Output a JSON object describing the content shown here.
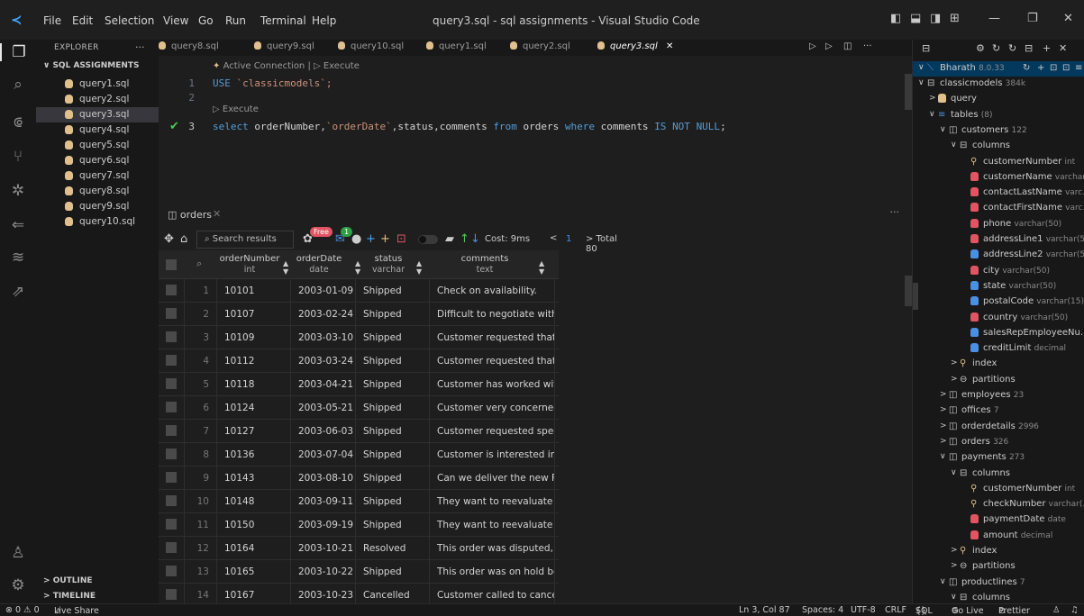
{
  "window": {
    "menu": [
      "File",
      "Edit",
      "Selection",
      "View",
      "Go",
      "Run",
      "Terminal",
      "Help"
    ],
    "title": "query3.sql - sql assignments - Visual Studio Code"
  },
  "sidebar": {
    "header": "EXPLORER",
    "dots": "···",
    "folder": "SQL ASSIGNMENTS",
    "files": [
      "query1.sql",
      "query2.sql",
      "query3.sql",
      "query4.sql",
      "query5.sql",
      "query6.sql",
      "query7.sql",
      "query8.sql",
      "query9.sql",
      "query10.sql"
    ],
    "active_file": "query3.sql",
    "outline": "OUTLINE",
    "timeline": "TIMELINE"
  },
  "tabs": [
    "query8.sql",
    "query9.sql",
    "query10.sql",
    "query1.sql",
    "query2.sql",
    "query3.sql"
  ],
  "active_tab": "query3.sql",
  "editor": {
    "codelens_top": "Active Connection | ▷ Execute",
    "codelens_mid": "▷ Execute",
    "lines": [
      {
        "n": "1",
        "kw": "USE",
        "rest": " `classicmodels`;"
      },
      {
        "n": "2"
      },
      {
        "n": "3",
        "text": "select orderNumber,`orderDate`,status,comments from orders where comments IS NOT NULL;"
      }
    ]
  },
  "results": {
    "tab_label": "orders",
    "search_placeholder": "Search results",
    "badge_free": "Free",
    "badge_count": "1",
    "cost": "Cost: 9ms",
    "page_prev": "<",
    "page": "1",
    "total": "> Total 80",
    "columns": [
      {
        "name": "orderNumber",
        "type": "int"
      },
      {
        "name": "orderDate",
        "type": "date"
      },
      {
        "name": "status",
        "type": "varchar"
      },
      {
        "name": "comments",
        "type": "text"
      }
    ],
    "rows": [
      [
        "1",
        "10101",
        "2003-01-09",
        "Shipped",
        "Check on availability."
      ],
      [
        "2",
        "10107",
        "2003-02-24",
        "Shipped",
        "Difficult to negotiate with c"
      ],
      [
        "3",
        "10109",
        "2003-03-10",
        "Shipped",
        "Customer requested that Fe"
      ],
      [
        "4",
        "10112",
        "2003-03-24",
        "Shipped",
        "Customer requested that ac"
      ],
      [
        "5",
        "10118",
        "2003-04-21",
        "Shipped",
        "Customer has worked with"
      ],
      [
        "6",
        "10124",
        "2003-05-21",
        "Shipped",
        "Customer very concerned a"
      ],
      [
        "7",
        "10127",
        "2003-06-03",
        "Shipped",
        "Customer requested specia"
      ],
      [
        "8",
        "10136",
        "2003-07-04",
        "Shipped",
        "Customer is interested in bu"
      ],
      [
        "9",
        "10143",
        "2003-08-10",
        "Shipped",
        "Can we deliver the new For"
      ],
      [
        "10",
        "10148",
        "2003-09-11",
        "Shipped",
        "They want to reevaluate the"
      ],
      [
        "11",
        "10150",
        "2003-09-19",
        "Shipped",
        "They want to reevaluate the"
      ],
      [
        "12",
        "10164",
        "2003-10-21",
        "Resolved",
        "This order was disputed, bu"
      ],
      [
        "13",
        "10165",
        "2003-10-22",
        "Shipped",
        "This order was on hold bec"
      ],
      [
        "14",
        "10167",
        "2003-10-23",
        "Cancelled",
        "Customer called to cancel."
      ]
    ]
  },
  "db": {
    "connection": "Bharath",
    "connection_version": "8.0.33",
    "tree": [
      {
        "d": 1,
        "chev": "∨",
        "icon": "db",
        "label": "classicmodels",
        "meta": "384k"
      },
      {
        "d": 2,
        "chev": ">",
        "icon": "query",
        "label": "query",
        "meta": ""
      },
      {
        "d": 2,
        "chev": "∨",
        "icon": "list",
        "label": "tables",
        "meta": "(8)"
      },
      {
        "d": 3,
        "chev": "∨",
        "icon": "table",
        "label": "customers",
        "meta": "122"
      },
      {
        "d": 4,
        "chev": "∨",
        "icon": "cols",
        "label": "columns",
        "meta": ""
      },
      {
        "d": 5,
        "chev": "",
        "icon": "key",
        "label": "customerNumber",
        "meta": "int"
      },
      {
        "d": 5,
        "chev": "",
        "icon": "red",
        "label": "customerName",
        "meta": "varchar..."
      },
      {
        "d": 5,
        "chev": "",
        "icon": "red",
        "label": "contactLastName",
        "meta": "varc..."
      },
      {
        "d": 5,
        "chev": "",
        "icon": "red",
        "label": "contactFirstName",
        "meta": "varc..."
      },
      {
        "d": 5,
        "chev": "",
        "icon": "red",
        "label": "phone",
        "meta": "varchar(50)"
      },
      {
        "d": 5,
        "chev": "",
        "icon": "red",
        "label": "addressLine1",
        "meta": "varchar(50)"
      },
      {
        "d": 5,
        "chev": "",
        "icon": "blue",
        "label": "addressLine2",
        "meta": "varchar(50)"
      },
      {
        "d": 5,
        "chev": "",
        "icon": "red",
        "label": "city",
        "meta": "varchar(50)"
      },
      {
        "d": 5,
        "chev": "",
        "icon": "blue",
        "label": "state",
        "meta": "varchar(50)"
      },
      {
        "d": 5,
        "chev": "",
        "icon": "blue",
        "label": "postalCode",
        "meta": "varchar(15)"
      },
      {
        "d": 5,
        "chev": "",
        "icon": "red",
        "label": "country",
        "meta": "varchar(50)"
      },
      {
        "d": 5,
        "chev": "",
        "icon": "blue",
        "label": "salesRepEmployeeNu...",
        "meta": ""
      },
      {
        "d": 5,
        "chev": "",
        "icon": "blue",
        "label": "creditLimit",
        "meta": "decimal"
      },
      {
        "d": 4,
        "chev": ">",
        "icon": "key",
        "label": "index",
        "meta": ""
      },
      {
        "d": 4,
        "chev": ">",
        "icon": "part",
        "label": "partitions",
        "meta": ""
      },
      {
        "d": 3,
        "chev": ">",
        "icon": "table",
        "label": "employees",
        "meta": "23"
      },
      {
        "d": 3,
        "chev": ">",
        "icon": "table",
        "label": "offices",
        "meta": "7"
      },
      {
        "d": 3,
        "chev": ">",
        "icon": "table",
        "label": "orderdetails",
        "meta": "2996"
      },
      {
        "d": 3,
        "chev": ">",
        "icon": "table",
        "label": "orders",
        "meta": "326"
      },
      {
        "d": 3,
        "chev": "∨",
        "icon": "table",
        "label": "payments",
        "meta": "273"
      },
      {
        "d": 4,
        "chev": "∨",
        "icon": "cols",
        "label": "columns",
        "meta": ""
      },
      {
        "d": 5,
        "chev": "",
        "icon": "key",
        "label": "customerNumber",
        "meta": "int"
      },
      {
        "d": 5,
        "chev": "",
        "icon": "key",
        "label": "checkNumber",
        "meta": "varchar(..."
      },
      {
        "d": 5,
        "chev": "",
        "icon": "red",
        "label": "paymentDate",
        "meta": "date"
      },
      {
        "d": 5,
        "chev": "",
        "icon": "red",
        "label": "amount",
        "meta": "decimal"
      },
      {
        "d": 4,
        "chev": ">",
        "icon": "key",
        "label": "index",
        "meta": ""
      },
      {
        "d": 4,
        "chev": ">",
        "icon": "part",
        "label": "partitions",
        "meta": ""
      },
      {
        "d": 3,
        "chev": "∨",
        "icon": "table",
        "label": "productlines",
        "meta": "7"
      },
      {
        "d": 4,
        "chev": "∨",
        "icon": "cols",
        "label": "columns",
        "meta": ""
      }
    ]
  },
  "statusbar": {
    "left": "⊗ 0 ⚠ 0",
    "liveshare": "Live Share",
    "position": "Ln 3, Col 87",
    "spaces": "Spaces: 4",
    "encoding": "UTF-8",
    "eol": "CRLF",
    "language": "SQL",
    "golive": "Go Live",
    "prettier": "Prettier"
  },
  "colors": {
    "accent": "#007acc",
    "column_red": "#e05561",
    "column_blue": "#4a90e2",
    "key_yellow": "#e2c08d",
    "db_icon_yellow": "#e2c08d"
  }
}
